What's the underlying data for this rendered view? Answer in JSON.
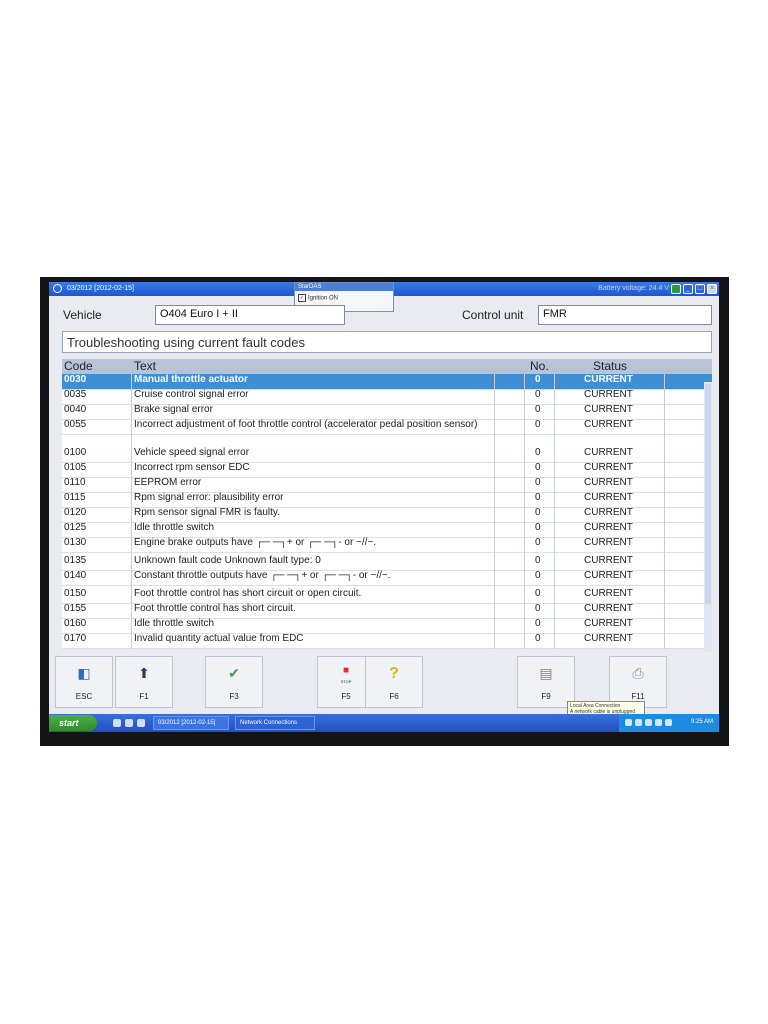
{
  "window": {
    "title": "03/2012 [2012-02-15]",
    "battery": "Battery voltage: 24.4 V",
    "btn_min": "_",
    "btn_max": "□",
    "btn_close": "×"
  },
  "popup": {
    "title": "StarDAS",
    "item": "Ignition ON"
  },
  "vehicle": {
    "label": "Vehicle",
    "value": "O404 Euro I + II"
  },
  "control_unit": {
    "label": "Control unit",
    "value": "FMR"
  },
  "heading": "Troubleshooting using current fault codes",
  "table": {
    "headers": {
      "code": "Code",
      "text": "Text",
      "no": "No.",
      "status": "Status"
    },
    "rows": [
      {
        "code": "0030",
        "text": "Manual throttle actuator",
        "no": "0",
        "status": "CURRENT"
      },
      {
        "code": "0035",
        "text": "Cruise control signal error",
        "no": "0",
        "status": "CURRENT"
      },
      {
        "code": "0040",
        "text": "Brake signal error",
        "no": "0",
        "status": "CURRENT"
      },
      {
        "code": "0055",
        "text": "Incorrect adjustment of foot throttle control (accelerator pedal position sensor)",
        "no": "0",
        "status": "CURRENT"
      },
      {
        "code": "0100",
        "text": "Vehicle speed signal error",
        "no": "0",
        "status": "CURRENT"
      },
      {
        "code": "0105",
        "text": "Incorrect rpm sensor EDC",
        "no": "0",
        "status": "CURRENT"
      },
      {
        "code": "0110",
        "text": "EEPROM error",
        "no": "0",
        "status": "CURRENT"
      },
      {
        "code": "0115",
        "text": "Rpm signal error: plausibility error",
        "no": "0",
        "status": "CURRENT"
      },
      {
        "code": "0120",
        "text": "Rpm sensor signal FMR is faulty.",
        "no": "0",
        "status": "CURRENT"
      },
      {
        "code": "0125",
        "text": "Idle throttle switch",
        "no": "0",
        "status": "CURRENT"
      },
      {
        "code": "0130",
        "text": "Engine brake outputs have ┌─ ─┐+ or ┌─ ─┐- or ~//~.",
        "no": "0",
        "status": "CURRENT"
      },
      {
        "code": "0135",
        "text": "Unknown fault code Unknown fault type: 0",
        "no": "0",
        "status": "CURRENT"
      },
      {
        "code": "0140",
        "text": "Constant throttle outputs have ┌─ ─┐+ or ┌─ ─┐- or ~//~.",
        "no": "0",
        "status": "CURRENT"
      },
      {
        "code": "0150",
        "text": "Foot throttle control has short circuit or open circuit.",
        "no": "0",
        "status": "CURRENT"
      },
      {
        "code": "0155",
        "text": "Foot throttle control has short circuit.",
        "no": "0",
        "status": "CURRENT"
      },
      {
        "code": "0160",
        "text": "Idle throttle switch",
        "no": "0",
        "status": "CURRENT"
      },
      {
        "code": "0170",
        "text": "Invalid quantity actual value from EDC",
        "no": "0",
        "status": "CURRENT"
      }
    ]
  },
  "fkeys": [
    {
      "label": "ESC",
      "icon": "exit-icon"
    },
    {
      "label": "F1",
      "icon": "arrow-up-icon"
    },
    {
      "label": "F3",
      "icon": "checkmark-icon"
    },
    {
      "label": "F5",
      "icon": "stop-icon",
      "sub": "STOP"
    },
    {
      "label": "F6",
      "icon": "help-icon"
    },
    {
      "label": "F9",
      "icon": "document-icon"
    },
    {
      "label": "F11",
      "icon": "printer-icon"
    }
  ],
  "tooltip": {
    "line1": "Local Area Connection",
    "line2": "A network cable is unplugged"
  },
  "taskbar": {
    "start": "start",
    "item1": "03/2012 [2012-02-15]",
    "item2": "Network Connections",
    "clock": "9:25 AM"
  },
  "colors": {
    "selected_row": "#3f8fd7",
    "title_bar": "#1d57cf",
    "start_button": "#2f8a2c",
    "check_green": "#3aa14a",
    "stop_red": "#d63030"
  }
}
